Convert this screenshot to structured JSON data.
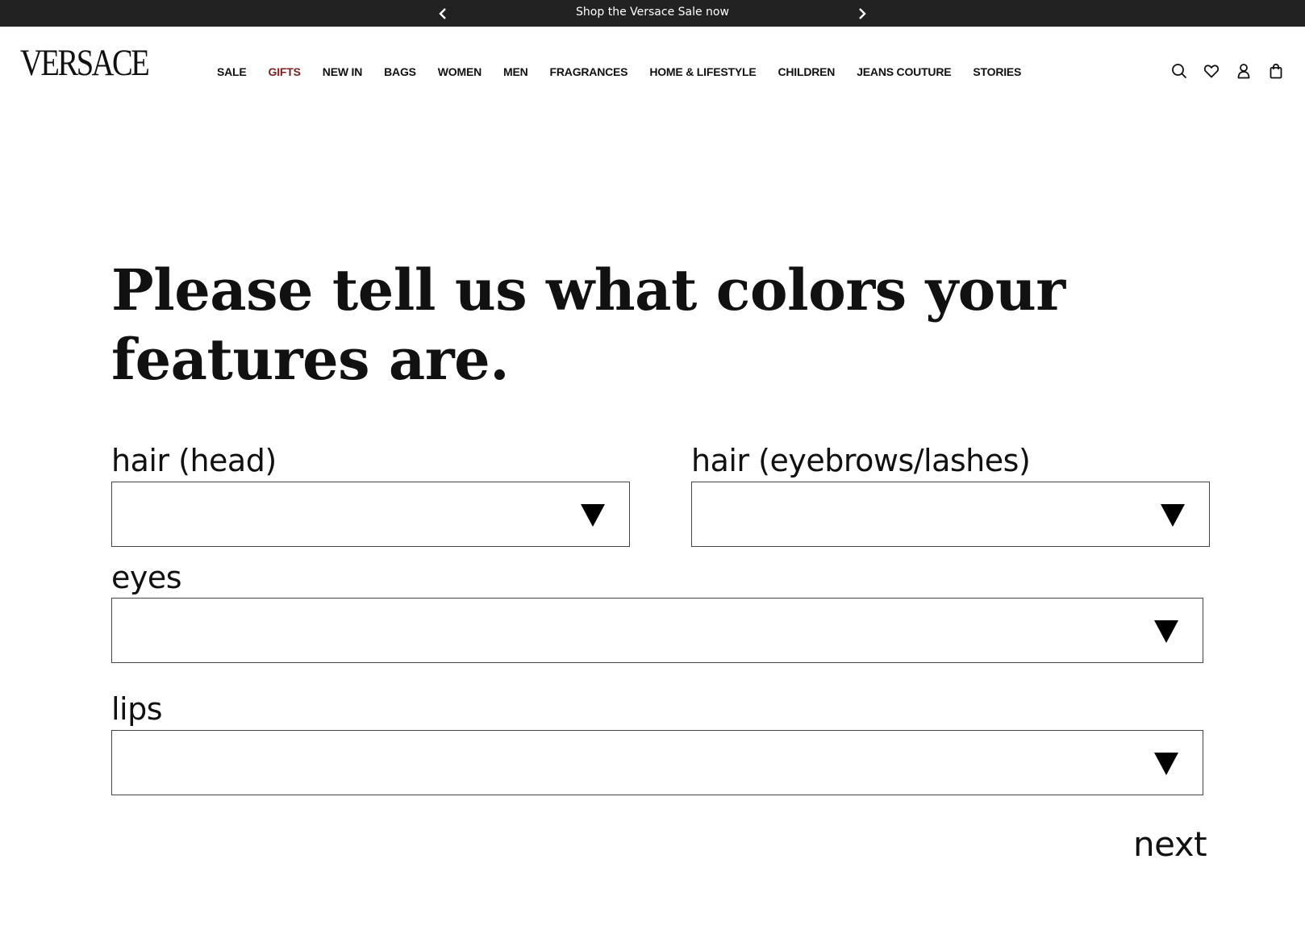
{
  "promo": {
    "text": "Shop the Versace Sale now",
    "prev_icon": "chevron-left-icon",
    "next_icon": "chevron-right-icon"
  },
  "header": {
    "logo": "VERSACE",
    "nav": [
      {
        "label": "SALE"
      },
      {
        "label": "GIFTS",
        "accent": true
      },
      {
        "label": "NEW IN"
      },
      {
        "label": "BAGS"
      },
      {
        "label": "WOMEN"
      },
      {
        "label": "MEN"
      },
      {
        "label": "FRAGRANCES"
      },
      {
        "label": "HOME & LIFESTYLE"
      },
      {
        "label": "CHILDREN"
      },
      {
        "label": "JEANS COUTURE"
      },
      {
        "label": "STORIES"
      }
    ],
    "icons": [
      "search-icon",
      "heart-icon",
      "account-icon",
      "shopping-bag-icon"
    ]
  },
  "colors": {
    "promo_bg": "#222222",
    "accent": "#7a1f1f",
    "text": "#111111",
    "border": "#444444"
  },
  "main": {
    "title": "Please tell us what colors your features are.",
    "fields": {
      "hair_head": {
        "label": "hair (head)",
        "value": ""
      },
      "hair_brows": {
        "label": "hair (eyebrows/lashes)",
        "value": ""
      },
      "eyes": {
        "label": "eyes",
        "value": ""
      },
      "lips": {
        "label": "lips",
        "value": ""
      }
    },
    "next_label": "next"
  }
}
